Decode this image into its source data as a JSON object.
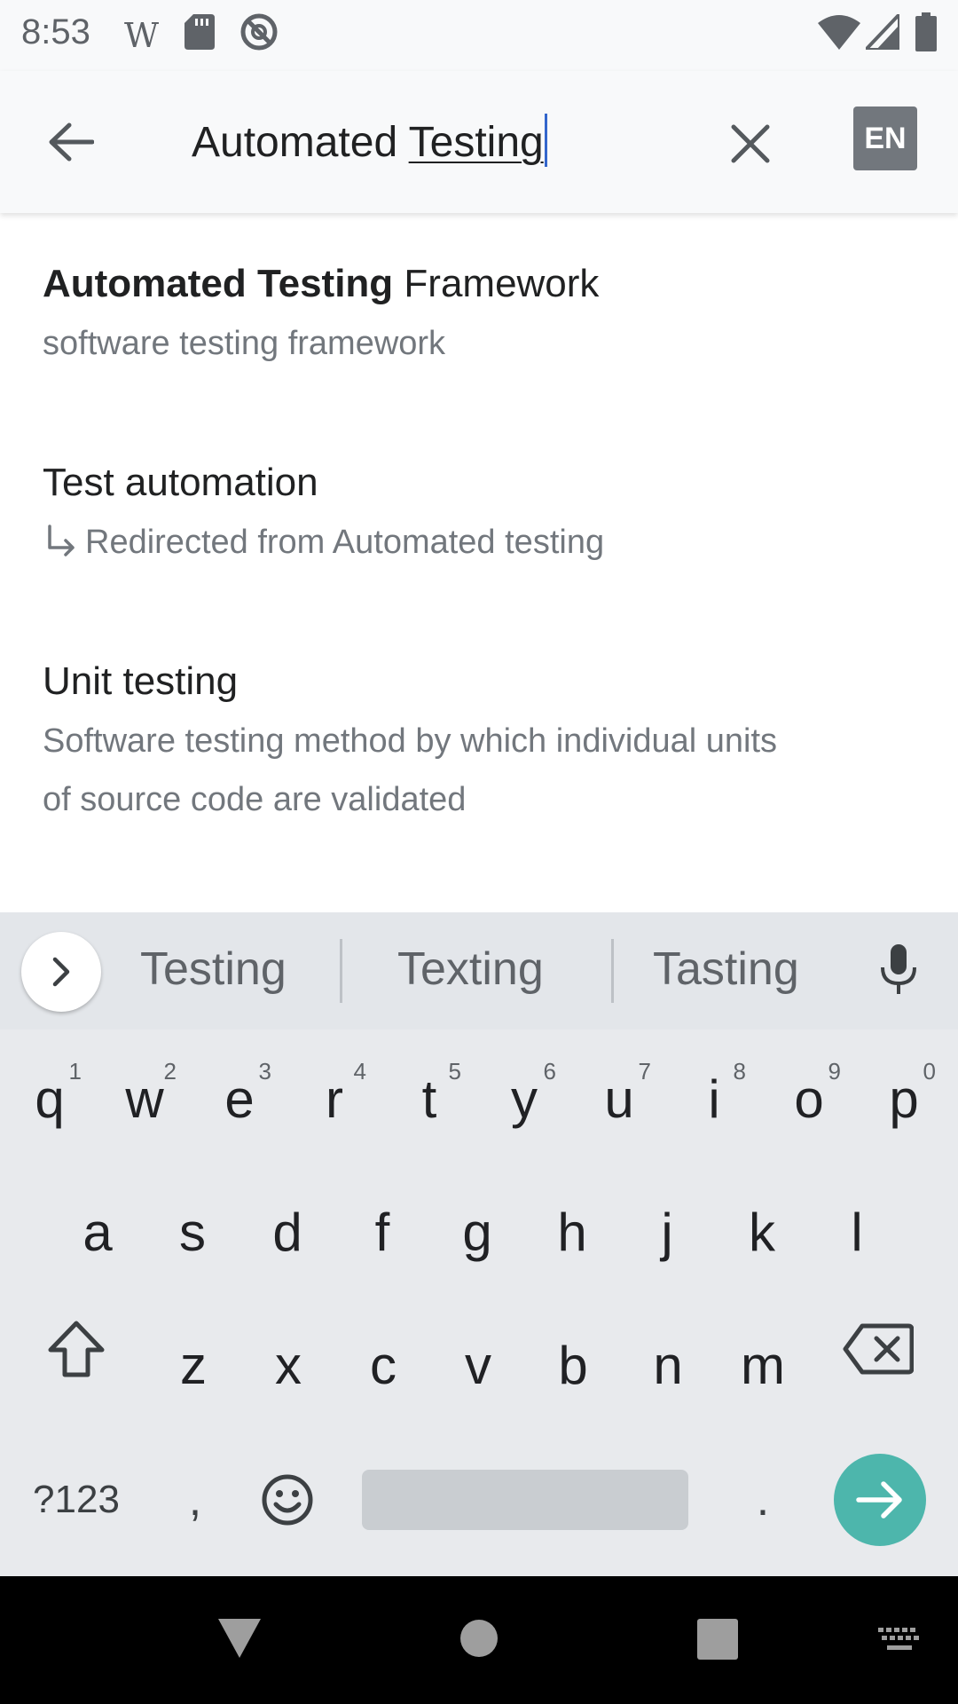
{
  "status_bar": {
    "time": "8:53"
  },
  "search": {
    "query_prefix": "Automated ",
    "query_composing": "Testing",
    "language_button": "EN"
  },
  "results": [
    {
      "title_bold": "Automated Testing",
      "title_rest": " Framework",
      "description": "software testing framework"
    },
    {
      "title": "Test automation",
      "redirect": "Redirected from Automated testing"
    },
    {
      "title": "Unit testing",
      "description_line1": "Software testing method by which individual units",
      "description_line2": "of source code are validated"
    }
  ],
  "keyboard": {
    "suggestions": [
      "Testing",
      "Texting",
      "Tasting"
    ],
    "row1": [
      "q",
      "w",
      "e",
      "r",
      "t",
      "y",
      "u",
      "i",
      "o",
      "p"
    ],
    "row1_hints": [
      "1",
      "2",
      "3",
      "4",
      "5",
      "6",
      "7",
      "8",
      "9",
      "0"
    ],
    "row2": [
      "a",
      "s",
      "d",
      "f",
      "g",
      "h",
      "j",
      "k",
      "l"
    ],
    "row3": [
      "z",
      "x",
      "c",
      "v",
      "b",
      "n",
      "m"
    ],
    "symbols_label": "?123",
    "comma": ",",
    "period": "."
  },
  "colors": {
    "accent": "#3366cc",
    "enter_key": "#4db6ac",
    "lang_badge": "#72777d"
  }
}
